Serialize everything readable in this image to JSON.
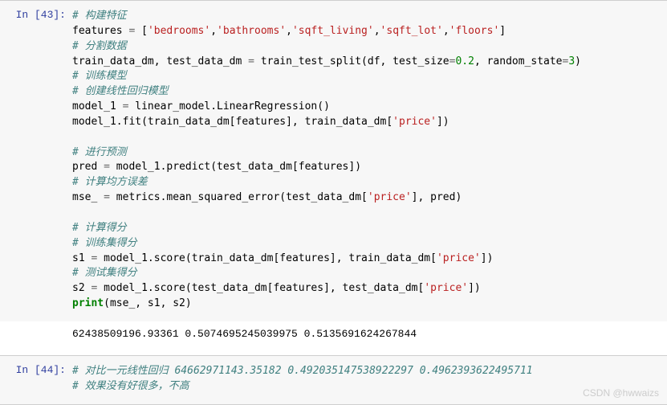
{
  "cells": [
    {
      "prompt_label": "In [43]:",
      "code_lines": [
        [
          {
            "cls": "c",
            "t": "# 构建特征"
          }
        ],
        [
          {
            "cls": "",
            "t": "features "
          },
          {
            "cls": "op",
            "t": "= "
          },
          {
            "cls": "",
            "t": "["
          },
          {
            "cls": "s",
            "t": "'bedrooms'"
          },
          {
            "cls": "",
            "t": ","
          },
          {
            "cls": "s",
            "t": "'bathrooms'"
          },
          {
            "cls": "",
            "t": ","
          },
          {
            "cls": "s",
            "t": "'sqft_living'"
          },
          {
            "cls": "",
            "t": ","
          },
          {
            "cls": "s",
            "t": "'sqft_lot'"
          },
          {
            "cls": "",
            "t": ","
          },
          {
            "cls": "s",
            "t": "'floors'"
          },
          {
            "cls": "",
            "t": "]"
          }
        ],
        [
          {
            "cls": "c",
            "t": "# 分割数据"
          }
        ],
        [
          {
            "cls": "",
            "t": "train_data_dm, test_data_dm "
          },
          {
            "cls": "op",
            "t": "= "
          },
          {
            "cls": "",
            "t": "train_test_split(df, test_size"
          },
          {
            "cls": "op",
            "t": "="
          },
          {
            "cls": "n",
            "t": "0.2"
          },
          {
            "cls": "",
            "t": ", random_state"
          },
          {
            "cls": "op",
            "t": "="
          },
          {
            "cls": "n",
            "t": "3"
          },
          {
            "cls": "",
            "t": ")"
          }
        ],
        [
          {
            "cls": "c",
            "t": "# 训练模型"
          }
        ],
        [
          {
            "cls": "c",
            "t": "# 创建线性回归模型"
          }
        ],
        [
          {
            "cls": "",
            "t": "model_1 "
          },
          {
            "cls": "op",
            "t": "= "
          },
          {
            "cls": "",
            "t": "linear_model.LinearRegression()"
          }
        ],
        [
          {
            "cls": "",
            "t": "model_1.fit(train_data_dm[features], train_data_dm["
          },
          {
            "cls": "s",
            "t": "'price'"
          },
          {
            "cls": "",
            "t": "])"
          }
        ],
        [
          {
            "cls": "",
            "t": ""
          }
        ],
        [
          {
            "cls": "c",
            "t": "# 进行预测"
          }
        ],
        [
          {
            "cls": "",
            "t": "pred "
          },
          {
            "cls": "op",
            "t": "= "
          },
          {
            "cls": "",
            "t": "model_1.predict(test_data_dm[features])"
          }
        ],
        [
          {
            "cls": "c",
            "t": "# 计算均方误差"
          }
        ],
        [
          {
            "cls": "",
            "t": "mse_ "
          },
          {
            "cls": "op",
            "t": "= "
          },
          {
            "cls": "",
            "t": "metrics.mean_squared_error(test_data_dm["
          },
          {
            "cls": "s",
            "t": "'price'"
          },
          {
            "cls": "",
            "t": "], pred)"
          }
        ],
        [
          {
            "cls": "",
            "t": ""
          }
        ],
        [
          {
            "cls": "c",
            "t": "# 计算得分"
          }
        ],
        [
          {
            "cls": "c",
            "t": "# 训练集得分"
          }
        ],
        [
          {
            "cls": "",
            "t": "s1 "
          },
          {
            "cls": "op",
            "t": "= "
          },
          {
            "cls": "",
            "t": "model_1.score(train_data_dm[features], train_data_dm["
          },
          {
            "cls": "s",
            "t": "'price'"
          },
          {
            "cls": "",
            "t": "])"
          }
        ],
        [
          {
            "cls": "c",
            "t": "# 测试集得分"
          }
        ],
        [
          {
            "cls": "",
            "t": "s2 "
          },
          {
            "cls": "op",
            "t": "= "
          },
          {
            "cls": "",
            "t": "model_1.score(test_data_dm[features], test_data_dm["
          },
          {
            "cls": "s",
            "t": "'price'"
          },
          {
            "cls": "",
            "t": "])"
          }
        ],
        [
          {
            "cls": "k",
            "t": "print"
          },
          {
            "cls": "",
            "t": "(mse_, s1, s2)"
          }
        ]
      ],
      "output": "62438509196.93361 0.5074695245039975 0.5135691624267844"
    },
    {
      "prompt_label": "In [44]:",
      "code_lines": [
        [
          {
            "cls": "c",
            "t": "# 对比一元线性回归 64662971143.35182 0.492035147538922297 0.4962393622495711"
          }
        ],
        [
          {
            "cls": "c",
            "t": "# 效果没有好很多，不高"
          }
        ]
      ],
      "output": null
    }
  ],
  "watermark": "CSDN @hwwaizs"
}
